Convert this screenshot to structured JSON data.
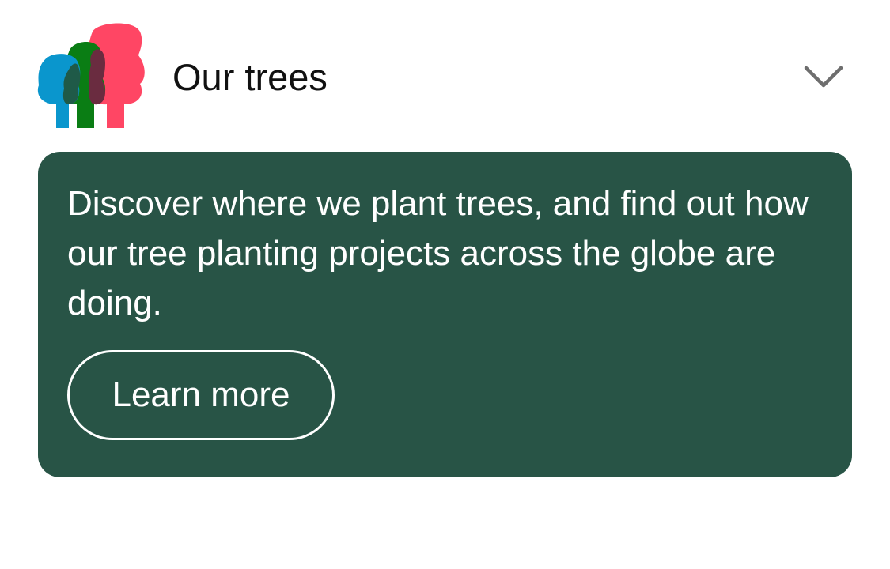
{
  "header": {
    "title": "Our trees",
    "logo_icon": "tree-trio-logo-icon",
    "expand_icon": "chevron-down-icon"
  },
  "card": {
    "description": "Discover where we plant trees, and find out how our tree planting projects across the globe are doing.",
    "button_label": "Learn more"
  },
  "colors": {
    "card_background": "#285446",
    "logo_blue": "#0a96cd",
    "logo_green": "#0a7d14",
    "logo_red": "#ff4664",
    "chevron": "#6e6e6e",
    "title_text": "#111111"
  }
}
